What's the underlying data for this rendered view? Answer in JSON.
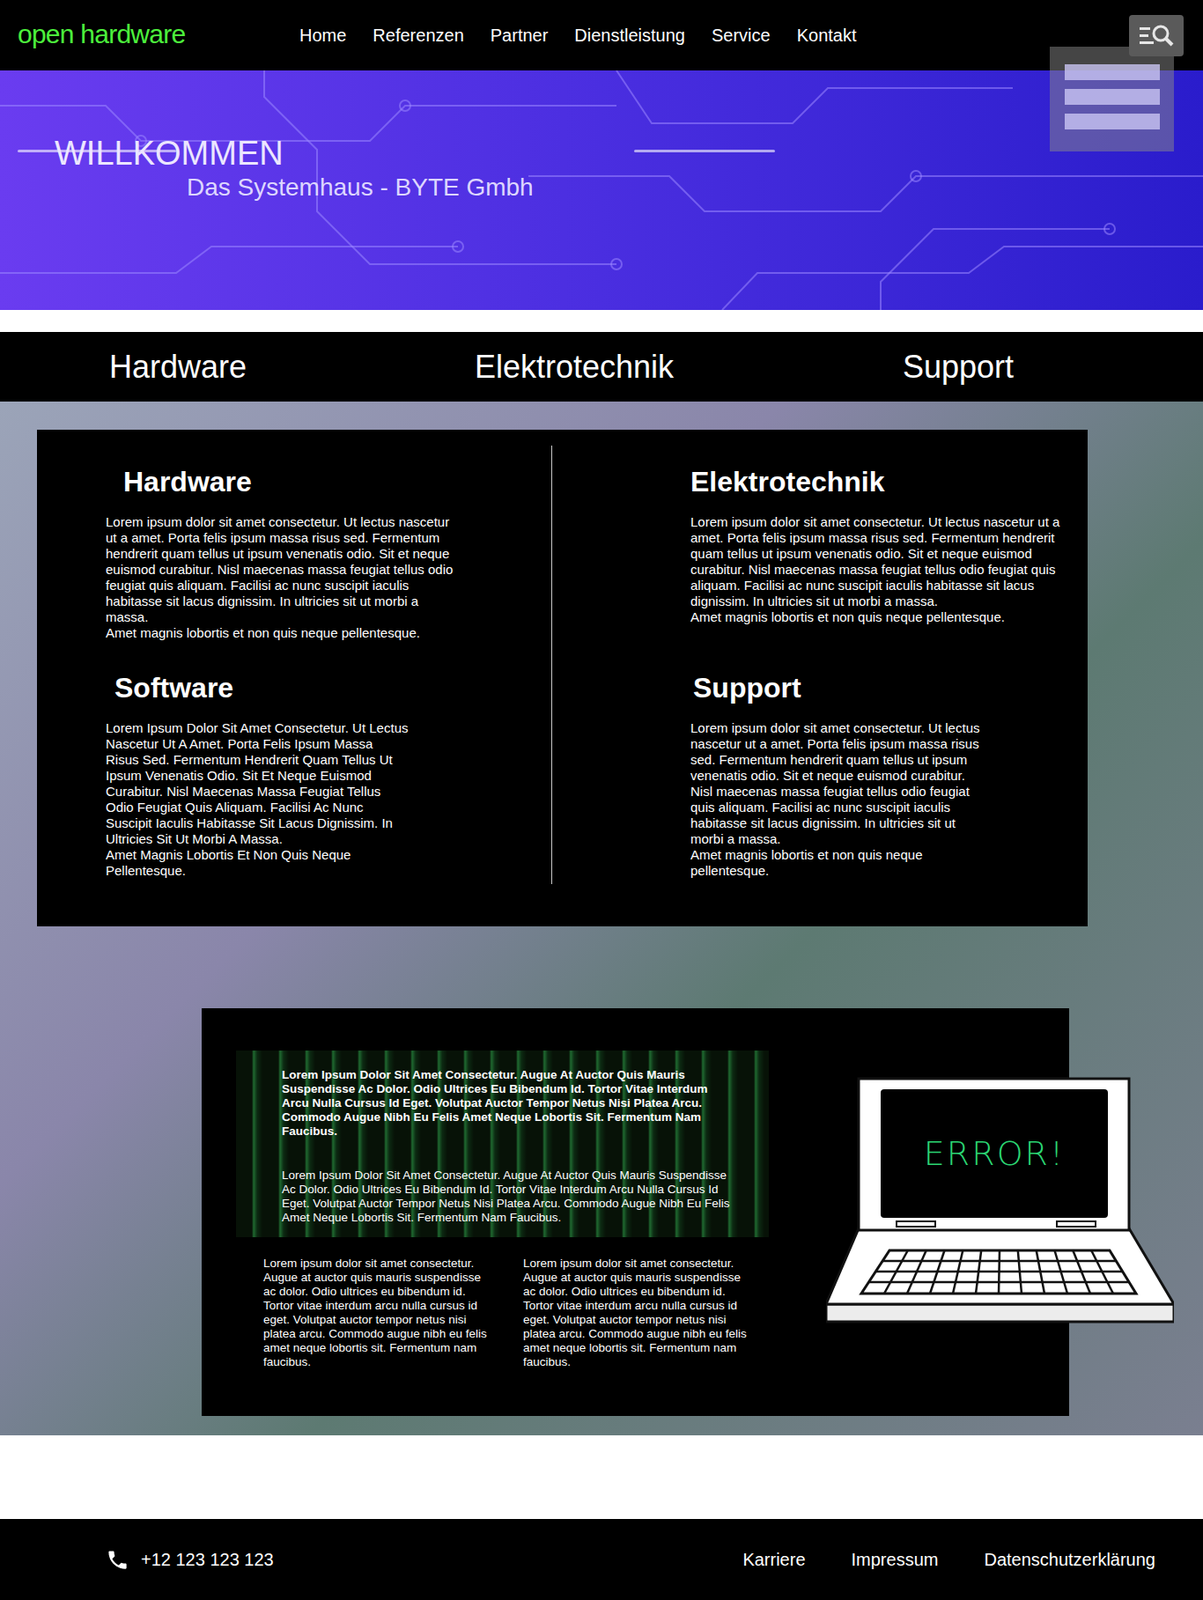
{
  "header": {
    "logo": "open hardware",
    "nav": [
      "Home",
      "Referenzen",
      "Partner",
      "Dienstleistung",
      "Service",
      "Kontakt"
    ]
  },
  "hero": {
    "title": "WILLKOMMEN",
    "subtitle": "Das Systemhaus - BYTE Gmbh"
  },
  "tabs": [
    "Hardware",
    "Elektrotechnik",
    "Support"
  ],
  "services": [
    {
      "title": "Hardware",
      "paragraphs": [
        "Lorem ipsum dolor sit amet consectetur. Ut lectus nascetur ut a amet. Porta felis ipsum massa risus sed. Fermentum hendrerit quam tellus ut ipsum venenatis odio. Sit et neque euismod curabitur. Nisl maecenas massa feugiat tellus odio feugiat quis aliquam. Facilisi ac nunc suscipit iaculis habitasse sit lacus dignissim. In ultricies sit ut morbi a massa.",
        "Amet magnis lobortis et non quis neque pellentesque."
      ]
    },
    {
      "title": "Elektrotechnik",
      "paragraphs": [
        "Lorem ipsum dolor sit amet consectetur. Ut lectus nascetur ut a amet. Porta felis ipsum massa risus sed. Fermentum hendrerit quam tellus ut ipsum venenatis odio. Sit et neque euismod curabitur. Nisl maecenas massa feugiat tellus odio feugiat quis aliquam. Facilisi ac nunc suscipit iaculis habitasse sit lacus dignissim. In ultricies sit ut morbi a massa.",
        "Amet magnis lobortis et non quis neque pellentesque."
      ]
    },
    {
      "title": "Software",
      "paragraphs": [
        "Lorem Ipsum Dolor Sit Amet Consectetur. Ut Lectus Nascetur Ut A Amet. Porta Felis Ipsum Massa Risus Sed. Fermentum Hendrerit Quam Tellus Ut Ipsum Venenatis Odio. Sit Et Neque Euismod Curabitur. Nisl Maecenas Massa Feugiat Tellus Odio Feugiat Quis Aliquam. Facilisi Ac Nunc Suscipit Iaculis Habitasse Sit Lacus Dignissim. In Ultricies Sit Ut Morbi A Massa.",
        "Amet Magnis Lobortis Et Non Quis Neque Pellentesque."
      ]
    },
    {
      "title": "Support",
      "paragraphs": [
        "Lorem ipsum dolor sit amet consectetur. Ut lectus nascetur ut a amet. Porta felis ipsum massa risus sed. Fermentum hendrerit quam tellus ut ipsum venenatis odio. Sit et neque euismod curabitur. Nisl maecenas massa feugiat tellus odio feugiat quis aliquam. Facilisi ac nunc suscipit iaculis habitasse sit lacus dignissim. In ultricies sit ut morbi a massa.",
        "Amet magnis lobortis et non quis neque pellentesque."
      ]
    }
  ],
  "feature": {
    "highlight": [
      "Lorem Ipsum Dolor Sit Amet Consectetur. Augue At Auctor Quis Mauris Suspendisse Ac Dolor. Odio Ultrices Eu Bibendum Id. Tortor Vitae Interdum Arcu Nulla Cursus Id Eget. Volutpat Auctor Tempor Netus Nisi Platea Arcu. Commodo Augue Nibh Eu Felis Amet Neque Lobortis Sit. Fermentum Nam Faucibus.",
      "Lorem Ipsum Dolor Sit Amet Consectetur. Augue At Auctor Quis Mauris Suspendisse Ac Dolor. Odio Ultrices Eu Bibendum Id. Tortor Vitae Interdum Arcu Nulla Cursus Id Eget. Volutpat Auctor Tempor Netus Nisi Platea Arcu. Commodo Augue Nibh Eu Felis Amet Neque Lobortis Sit. Fermentum Nam Faucibus."
    ],
    "columns": [
      "Lorem ipsum dolor sit amet consectetur. Augue at auctor quis mauris suspendisse ac dolor. Odio ultrices eu bibendum id. Tortor vitae interdum arcu nulla cursus id eget. Volutpat auctor tempor netus nisi platea arcu. Commodo augue nibh eu felis amet neque lobortis sit. Fermentum nam faucibus.",
      "Lorem ipsum dolor sit amet consectetur. Augue at auctor quis mauris suspendisse ac dolor. Odio ultrices eu bibendum id. Tortor vitae interdum arcu nulla cursus id eget. Volutpat auctor tempor netus nisi platea arcu. Commodo augue nibh eu felis amet neque lobortis sit. Fermentum nam faucibus."
    ],
    "screen_text": "ERROR!"
  },
  "footer": {
    "phone": "+12 123 123 123",
    "links": [
      "Karriere",
      "Impressum",
      "Datenschutzerklärung"
    ]
  }
}
